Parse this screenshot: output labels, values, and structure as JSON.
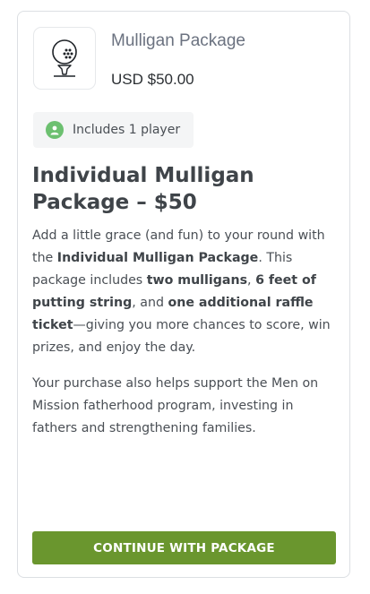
{
  "package": {
    "name": "Mulligan Package",
    "price": "USD $50.00",
    "icon": "golf-ball-on-tee-icon"
  },
  "badge": {
    "icon": "user-icon",
    "label": "Includes 1 player",
    "icon_color": "#6cc070"
  },
  "details": {
    "title": "Individual Mulligan Package – $50",
    "p1": [
      {
        "t": "Add a little grace (and fun) to your round with the ",
        "b": false
      },
      {
        "t": "Individual Mulligan Package",
        "b": true
      },
      {
        "t": ". This package includes ",
        "b": false
      },
      {
        "t": "two mulligans",
        "b": true
      },
      {
        "t": ", ",
        "b": false
      },
      {
        "t": "6 feet of putting string",
        "b": true
      },
      {
        "t": ", and ",
        "b": false
      },
      {
        "t": "one additional raffle ticket",
        "b": true
      },
      {
        "t": "—giving you more chances to score, win prizes, and enjoy the day.",
        "b": false
      }
    ],
    "p2": "Your purchase also helps support the Men on Mission fatherhood program, investing in fathers and strengthening families."
  },
  "cta": {
    "label": "CONTINUE WITH PACKAGE",
    "color": "#6a962e"
  }
}
